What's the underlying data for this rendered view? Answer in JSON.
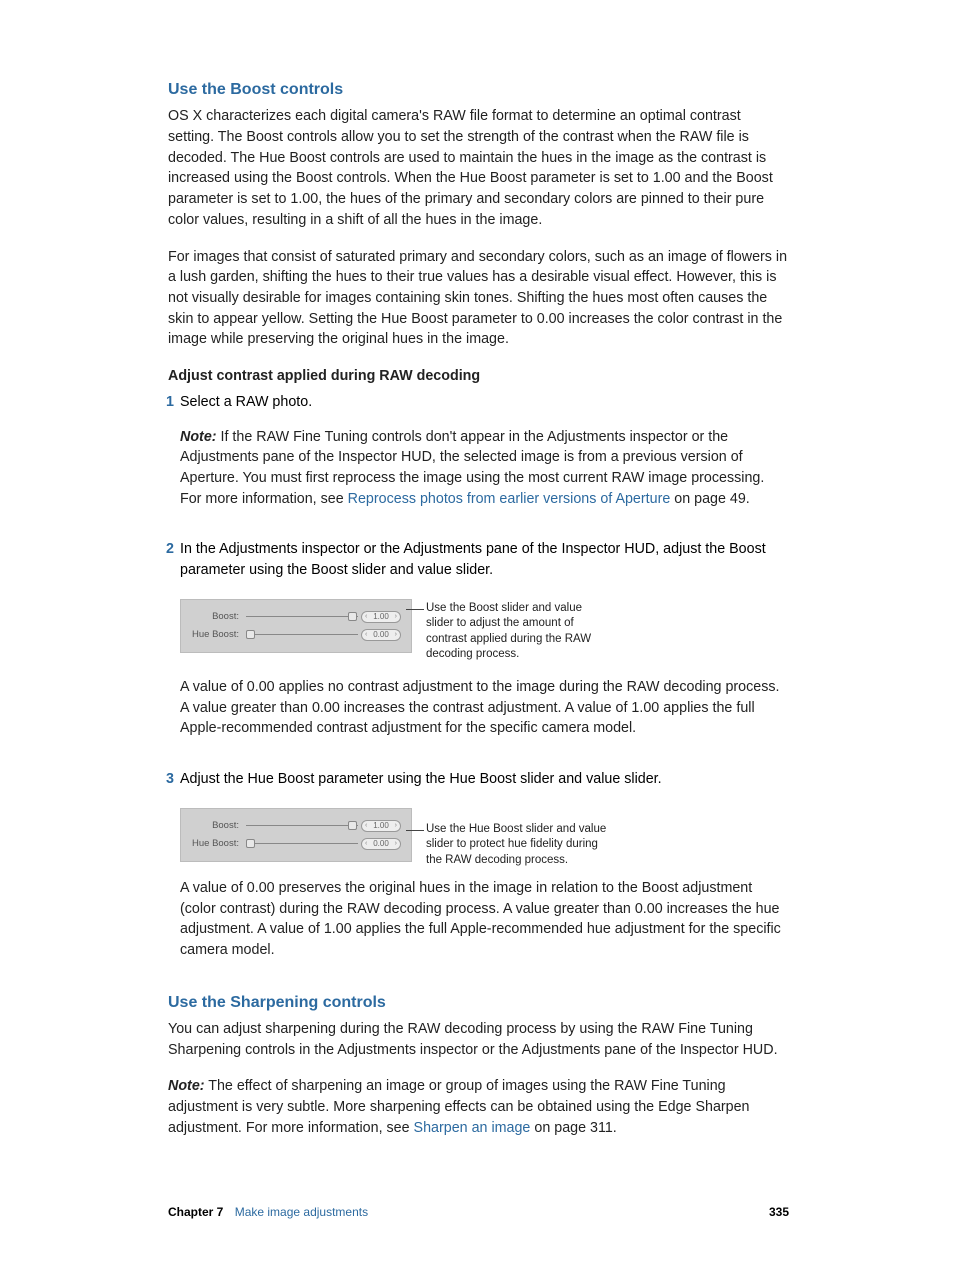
{
  "section1": {
    "heading": "Use the Boost controls",
    "para1": "OS X characterizes each digital camera's RAW file format to determine an optimal contrast setting. The Boost controls allow you to set the strength of the contrast when the RAW file is decoded. The Hue Boost controls are used to maintain the hues in the image as the contrast is increased using the Boost controls. When the Hue Boost parameter is set to 1.00 and the Boost parameter is set to 1.00, the hues of the primary and secondary colors are pinned to their pure color values, resulting in a shift of all the hues in the image.",
    "para2": "For images that consist of saturated primary and secondary colors, such as an image of flowers in a lush garden, shifting the hues to their true values has a desirable visual effect. However, this is not visually desirable for images containing skin tones. Shifting the hues most often causes the skin to appear yellow. Setting the Hue Boost parameter to 0.00 increases the color contrast in the image while preserving the original hues in the image.",
    "subheading": "Adjust contrast applied during RAW decoding",
    "step1": {
      "num": "1",
      "text": "Select a RAW photo.",
      "note_label": "Note:",
      "note_body_a": "  If the RAW Fine Tuning controls don't appear in the Adjustments inspector or the Adjustments pane of the Inspector HUD, the selected image is from a previous version of Aperture. You must first reprocess the image using the most current RAW image processing. For more information, see ",
      "note_link": "Reprocess photos from earlier versions of Aperture",
      "note_body_b": " on page 49."
    },
    "step2": {
      "num": "2",
      "text": "In the Adjustments inspector or the Adjustments pane of the Inspector HUD, adjust the Boost parameter using the Boost slider and value slider.",
      "panel": {
        "boost_label": "Boost:",
        "hue_label": "Hue Boost:",
        "boost_value": "1.00",
        "hue_value": "0.00"
      },
      "callout": "Use the Boost slider and value slider to adjust the amount of contrast applied during the RAW decoding process.",
      "after": "A value of 0.00 applies no contrast adjustment to the image during the RAW decoding process. A value greater than 0.00 increases the contrast adjustment. A value of 1.00 applies the full Apple-recommended contrast adjustment for the specific camera model."
    },
    "step3": {
      "num": "3",
      "text": "Adjust the Hue Boost parameter using the Hue Boost slider and value slider.",
      "panel": {
        "boost_label": "Boost:",
        "hue_label": "Hue Boost:",
        "boost_value": "1.00",
        "hue_value": "0.00"
      },
      "callout": "Use the Hue Boost slider and value slider to protect hue fidelity during the RAW decoding process.",
      "after": "A value of 0.00 preserves the original hues in the image in relation to the Boost adjustment (color contrast) during the RAW decoding process. A value greater than 0.00 increases the hue adjustment. A value of 1.00 applies the full Apple-recommended hue adjustment for the specific camera model."
    }
  },
  "section2": {
    "heading": "Use the Sharpening controls",
    "para1": "You can adjust sharpening during the RAW decoding process by using the RAW Fine Tuning Sharpening controls in the Adjustments inspector or the Adjustments pane of the Inspector HUD.",
    "note_label": "Note:",
    "note_body_a": "  The effect of sharpening an image or group of images using the RAW Fine Tuning adjustment is very subtle. More sharpening effects can be obtained using the Edge Sharpen adjustment. For more information, see ",
    "note_link": "Sharpen an image",
    "note_body_b": " on page 311."
  },
  "footer": {
    "chapter": "Chapter 7",
    "title": "Make image adjustments",
    "page": "335"
  },
  "glyphs": {
    "left": "‹",
    "right": "›"
  }
}
